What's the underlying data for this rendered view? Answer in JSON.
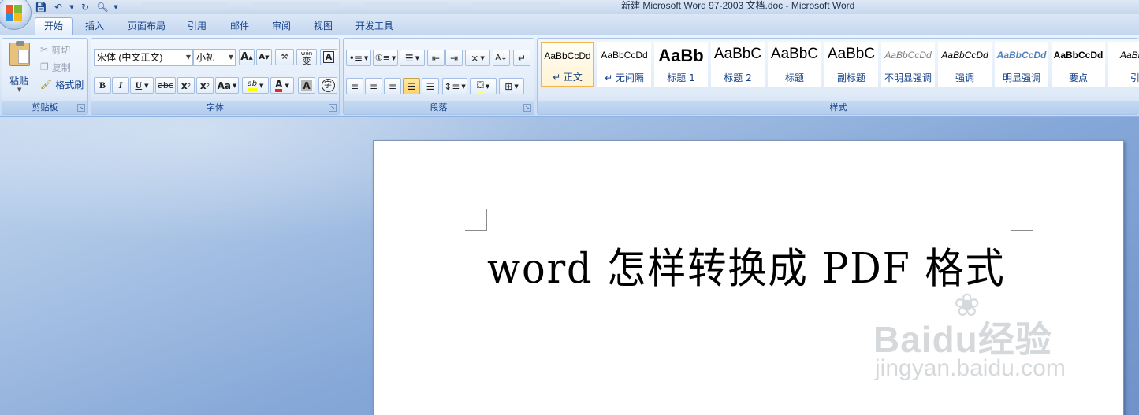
{
  "window": {
    "title": "新建 Microsoft Word 97-2003 文档.doc - Microsoft Word"
  },
  "quick_access": {
    "save_icon": "floppy-save-icon",
    "undo_icon": "undo-icon",
    "redo_icon": "redo-icon",
    "preview_icon": "print-preview-icon",
    "customize_icon": "chevron-down-icon"
  },
  "tabs": [
    "开始",
    "插入",
    "页面布局",
    "引用",
    "邮件",
    "审阅",
    "视图",
    "开发工具"
  ],
  "clipboard": {
    "paste_label": "粘贴",
    "cut_label": "剪切",
    "copy_label": "复制",
    "format_painter_label": "格式刷",
    "group_label": "剪贴板"
  },
  "font": {
    "font_name": "宋体 (中文正文)",
    "font_size": "小初",
    "grow_glyph": "A",
    "shrink_glyph": "A",
    "phonetic_glyph": "wén",
    "phonetic_char": "变",
    "bold": "B",
    "italic": "I",
    "underline": "U",
    "strike": "abc",
    "subscript": "x",
    "superscript": "x",
    "change_case": "Aa",
    "highlight": "ab",
    "font_color": "A",
    "char_shading": "A",
    "enclose": "字",
    "group_label": "字体"
  },
  "paragraph": {
    "group_label": "段落"
  },
  "styles": {
    "group_label": "样式",
    "items": [
      {
        "sample": "AaBbCcDd",
        "name": "↵ 正文",
        "size": 12,
        "weight": "normal",
        "italic": false,
        "color": "#000000",
        "active": true
      },
      {
        "sample": "AaBbCcDd",
        "name": "↵ 无间隔",
        "size": 12,
        "weight": "normal",
        "italic": false,
        "color": "#000000",
        "active": false
      },
      {
        "sample": "AaBb",
        "name": "标题 1",
        "size": 22,
        "weight": "bold",
        "italic": false,
        "color": "#000000",
        "active": false
      },
      {
        "sample": "AaBbC",
        "name": "标题 2",
        "size": 19,
        "weight": "normal",
        "italic": false,
        "color": "#000000",
        "active": false
      },
      {
        "sample": "AaBbC",
        "name": "标题",
        "size": 19,
        "weight": "normal",
        "italic": false,
        "color": "#000000",
        "active": false
      },
      {
        "sample": "AaBbC",
        "name": "副标题",
        "size": 19,
        "weight": "normal",
        "italic": false,
        "color": "#000000",
        "active": false
      },
      {
        "sample": "AaBbCcDd",
        "name": "不明显强调",
        "size": 12,
        "weight": "normal",
        "italic": true,
        "color": "#7f7f7f",
        "active": false
      },
      {
        "sample": "AaBbCcDd",
        "name": "强调",
        "size": 12,
        "weight": "normal",
        "italic": true,
        "color": "#000000",
        "active": false
      },
      {
        "sample": "AaBbCcDd",
        "name": "明显强调",
        "size": 12,
        "weight": "bold",
        "italic": true,
        "color": "#4f81bd",
        "active": false
      },
      {
        "sample": "AaBbCcDd",
        "name": "要点",
        "size": 12,
        "weight": "bold",
        "italic": false,
        "color": "#000000",
        "active": false
      },
      {
        "sample": "AaBbC",
        "name": "引",
        "size": 12,
        "weight": "normal",
        "italic": true,
        "color": "#000000",
        "active": false
      }
    ]
  },
  "document": {
    "heading": "word 怎样转换成 PDF 格式"
  },
  "watermark": {
    "logo_text": "Baidu经验",
    "url": "jingyan.baidu.com"
  }
}
